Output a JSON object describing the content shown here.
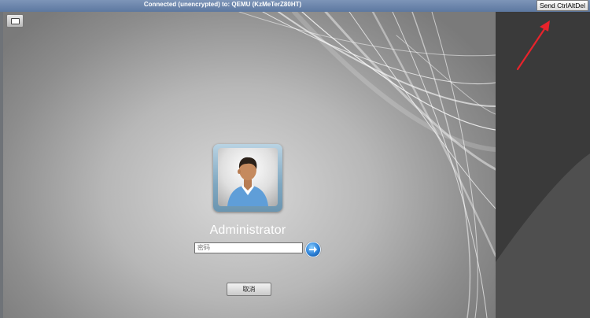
{
  "topbar": {
    "connection_text": "Connected (unencrypted) to: QEMU (KzMeTerZ80HT)",
    "send_cad_label": "Send CtrlAltDel"
  },
  "login": {
    "username": "Administrator",
    "password_placeholder": "密码",
    "password_value": "",
    "cancel_label": "取消"
  },
  "icons": {
    "toolbar": "keyboard-icon",
    "avatar": "user-avatar-icon",
    "submit": "arrow-right-icon",
    "annotation": "red-arrow-icon"
  },
  "colors": {
    "topbar": "#6d86ad",
    "right_panel": "#3a3a3a",
    "annotation_arrow": "#e8232b",
    "submit_button": "#2a7fd6"
  }
}
